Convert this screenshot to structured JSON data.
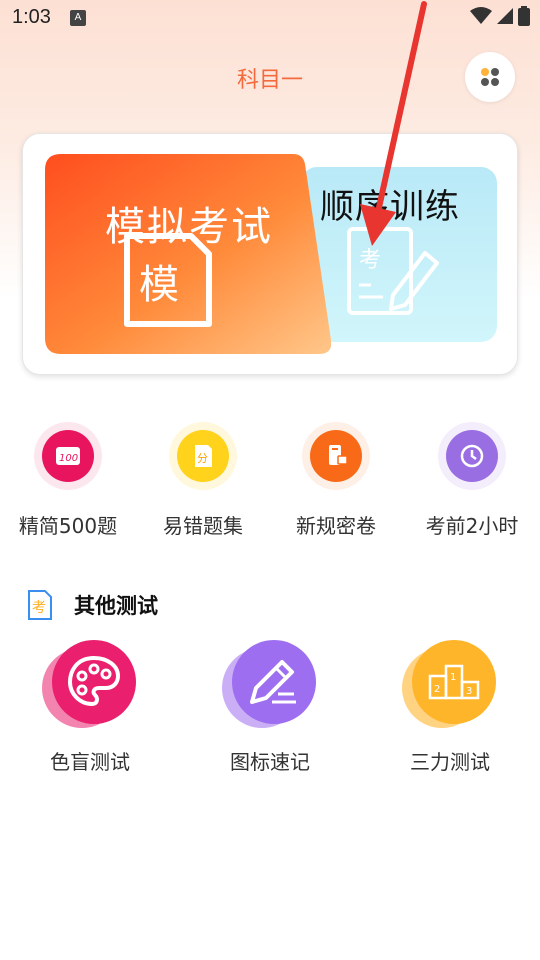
{
  "status": {
    "time": "1:03",
    "notif_letter": "A"
  },
  "header": {
    "title": "科目一"
  },
  "hero": {
    "mock_exam": "模拟考试",
    "mock_badge": "模",
    "sequential": "顺序训练",
    "seq_badge": "考"
  },
  "quick": [
    {
      "label": "精简500题",
      "badge": "100",
      "color": "#e8155e"
    },
    {
      "label": "易错题集",
      "badge": "分",
      "color": "#ffd21c"
    },
    {
      "label": "新规密卷",
      "color": "#f86a18"
    },
    {
      "label": "考前2小时",
      "color": "#9a6ee3"
    }
  ],
  "other_section": {
    "title": "其他测试",
    "icon_text": "考"
  },
  "tests": [
    {
      "label": "色盲测试",
      "color": "#ea1f6d"
    },
    {
      "label": "图标速记",
      "color": "#9e6ef0"
    },
    {
      "label": "三力测试",
      "color": "#ffae1c",
      "podium": [
        "2",
        "1",
        "3"
      ]
    }
  ],
  "colors": {
    "accent": "#f36b3d",
    "arrow": "#e8352f"
  }
}
